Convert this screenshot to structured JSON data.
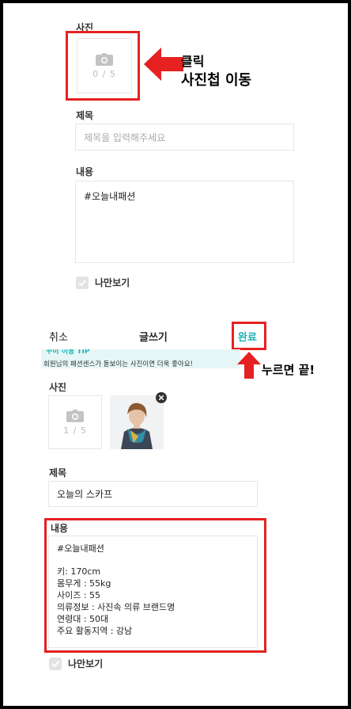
{
  "top": {
    "photo_label": "사진",
    "photo_count": "0 / 5",
    "callout": [
      "클릭",
      "사진첩 이동"
    ],
    "title_label": "제목",
    "title_placeholder": "제목을 입력해주세요",
    "content_label": "내용",
    "content_value": "#오늘내패션",
    "private_label": "나만보기"
  },
  "header": {
    "cancel": "취소",
    "title": "글쓰기",
    "done": "완료",
    "done_color": "#19b3b3"
  },
  "tip": {
    "title": "꾸미 이용 TIP",
    "text": "회원님의 패션센스가 돋보이는 사진이면 더욱 좋아요!"
  },
  "done_callout": "누르면 끝!",
  "bottom": {
    "photo_label": "사진",
    "photo_count": "1 / 5",
    "title_label": "제목",
    "title_value": "오늘의 스카프",
    "content_label": "내용",
    "content_lines": [
      "#오늘내패션",
      "",
      "키: 170cm",
      "몸무게 : 55kg",
      "사이즈 : 55",
      "의류정보 : 사진속 의류 브랜드명",
      "연령대 : 50대",
      "주요 활동지역 : 강남"
    ],
    "private_label": "나만보기"
  },
  "colors": {
    "accent": "#19b3b3",
    "annotation_red": "#e52121",
    "tip_bg": "#e6f6f6"
  },
  "icons": [
    "camera-icon",
    "arrow-right-icon",
    "arrow-up-icon",
    "check-icon",
    "close-icon"
  ]
}
